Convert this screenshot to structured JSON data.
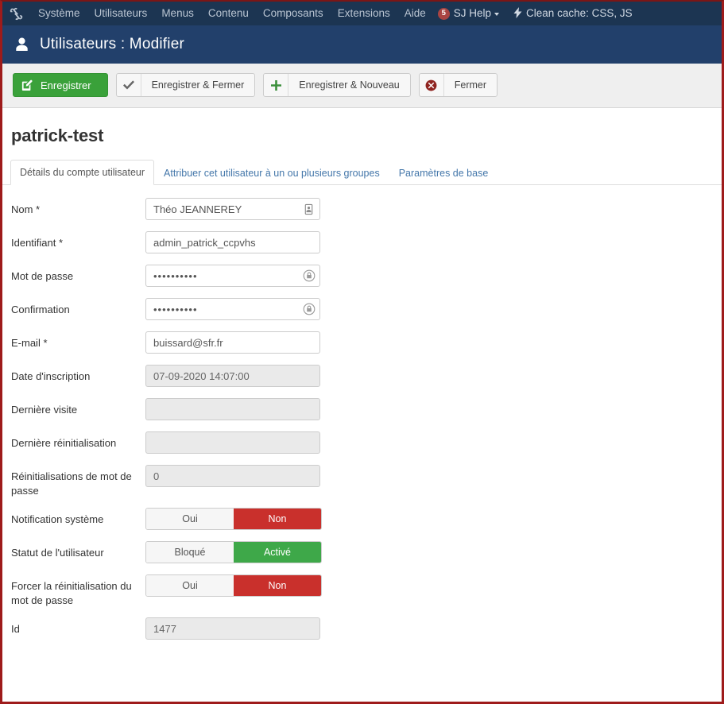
{
  "topnav": {
    "logo_icon": "joomla-logo-icon",
    "items": [
      {
        "label": "Système"
      },
      {
        "label": "Utilisateurs"
      },
      {
        "label": "Menus"
      },
      {
        "label": "Contenu"
      },
      {
        "label": "Composants"
      },
      {
        "label": "Extensions"
      },
      {
        "label": "Aide"
      }
    ],
    "sj_help": {
      "badge": "5",
      "label": "SJ Help",
      "caret_icon": "chevron-down-icon"
    },
    "clean_cache": {
      "icon": "lightning-bolt-icon",
      "label": "Clean cache: CSS, JS"
    }
  },
  "pageheader": {
    "icon": "user-icon",
    "title": "Utilisateurs : Modifier"
  },
  "toolbar": {
    "save": {
      "label": "Enregistrer",
      "icon": "edit-square-icon"
    },
    "save_close": {
      "label": "Enregistrer & Fermer",
      "icon": "check-icon"
    },
    "save_new": {
      "label": "Enregistrer & Nouveau",
      "icon": "plus-icon"
    },
    "close": {
      "label": "Fermer",
      "icon": "close-circle-icon"
    }
  },
  "document": {
    "title": "patrick-test"
  },
  "tabs": [
    {
      "label": "Détails du compte utilisateur",
      "active": true
    },
    {
      "label": "Attribuer cet utilisateur à un ou plusieurs groupes",
      "active": false
    },
    {
      "label": "Paramètres de base",
      "active": false
    }
  ],
  "form": {
    "name": {
      "label": "Nom *",
      "value": "Théo JEANNEREY",
      "icon": "contact-card-icon"
    },
    "username": {
      "label": "Identifiant *",
      "value": "admin_patrick_ccpvhs"
    },
    "password": {
      "label": "Mot de passe",
      "value": "••••••••••",
      "icon": "password-reveal-icon"
    },
    "password_confirm": {
      "label": "Confirmation",
      "value": "••••••••••",
      "icon": "password-reveal-icon"
    },
    "email": {
      "label": "E-mail *",
      "value": "buissard@sfr.fr"
    },
    "register_date": {
      "label": "Date d'inscription",
      "value": "07-09-2020 14:07:00"
    },
    "last_visit": {
      "label": "Dernière visite",
      "value": ""
    },
    "last_reset": {
      "label": "Dernière réinitialisation",
      "value": ""
    },
    "reset_count": {
      "label": "Réinitialisations de mot de passe",
      "value": "0"
    },
    "system_notification": {
      "label": "Notification système",
      "options": [
        "Oui",
        "Non"
      ],
      "selected": "Non"
    },
    "user_status": {
      "label": "Statut de l'utilisateur",
      "options": [
        "Bloqué",
        "Activé"
      ],
      "selected": "Activé"
    },
    "force_reset": {
      "label": "Forcer la réinitialisation du mot de passe",
      "options": [
        "Oui",
        "Non"
      ],
      "selected": "Non"
    },
    "id": {
      "label": "Id",
      "value": "1477"
    }
  },
  "colors": {
    "topnav_bg": "#1c3552",
    "header_bg": "#22406b",
    "toolbar_bg": "#efefef",
    "primary_green": "#3aa13a",
    "toggle_red": "#c9302c",
    "toggle_green": "#3ea849",
    "page_border": "#9e1b1b",
    "link_blue": "#4477aa"
  }
}
